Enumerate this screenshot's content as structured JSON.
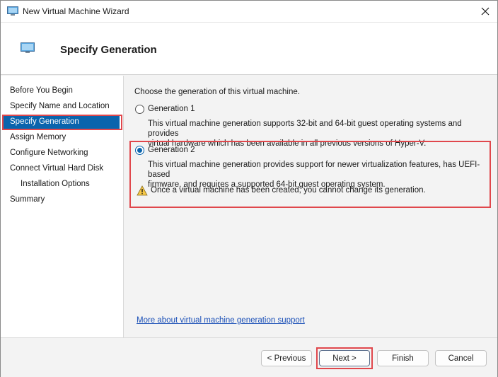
{
  "window": {
    "title": "New Virtual Machine Wizard",
    "close_icon": "close-icon"
  },
  "header": {
    "title": "Specify Generation"
  },
  "sidebar": {
    "items": [
      {
        "label": "Before You Begin"
      },
      {
        "label": "Specify Name and Location"
      },
      {
        "label": "Specify Generation",
        "active": true
      },
      {
        "label": "Assign Memory"
      },
      {
        "label": "Configure Networking"
      },
      {
        "label": "Connect Virtual Hard Disk"
      },
      {
        "label": "Installation Options",
        "indent": true
      },
      {
        "label": "Summary"
      }
    ]
  },
  "main": {
    "intro": "Choose the generation of this virtual machine.",
    "gen1": {
      "label": "Generation 1",
      "selected": false,
      "desc_line1": "This virtual machine generation supports 32-bit and 64-bit guest operating systems and provides",
      "desc_line2": "virtual hardware which has been available in all previous versions of Hyper-V."
    },
    "gen2": {
      "label": "Generation 2",
      "selected": true,
      "desc_line1": "This virtual machine generation provides support for newer virtualization features, has UEFI-based",
      "desc_line2": "firmware, and requires a supported 64-bit guest operating system."
    },
    "warning": "Once a virtual machine has been created, you cannot change its generation.",
    "link": "More about virtual machine generation support"
  },
  "footer": {
    "previous": "< Previous",
    "next": "Next >",
    "finish": "Finish",
    "cancel": "Cancel"
  },
  "colors": {
    "accent": "#0a64ad",
    "highlight": "#e0474c",
    "link": "#1a4fb7"
  }
}
